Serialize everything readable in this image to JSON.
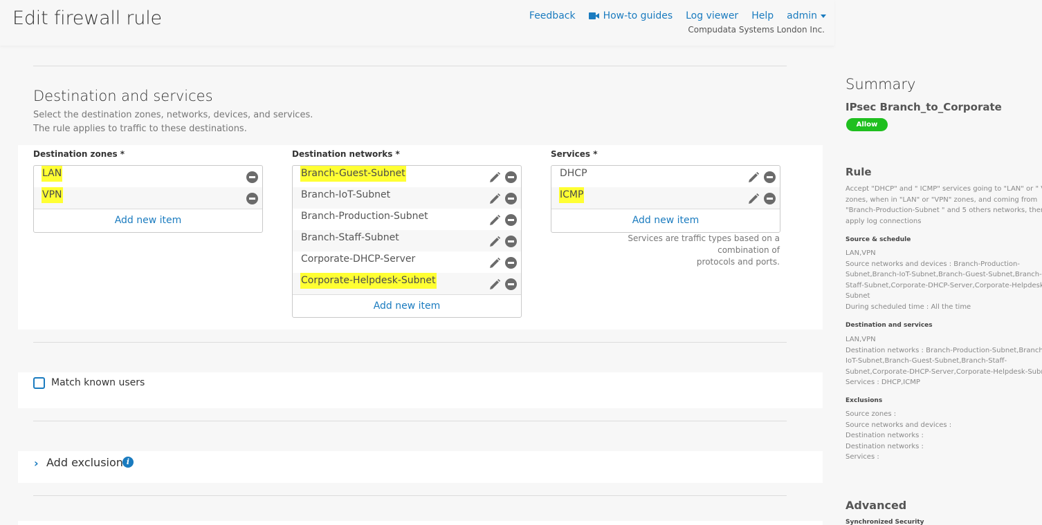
{
  "header": {
    "title": "Edit firewall rule",
    "nav": {
      "feedback": "Feedback",
      "howto": "How-to guides",
      "logviewer": "Log viewer",
      "help": "Help",
      "admin": "admin"
    },
    "company": "Compudata Systems London Inc."
  },
  "destination": {
    "title": "Destination and services",
    "desc1": "Select the destination zones, networks, devices, and services.",
    "desc2": "The rule applies to traffic to these destinations.",
    "zones": {
      "label": "Destination zones *",
      "items": [
        "LAN",
        "VPN"
      ],
      "add": "Add new item"
    },
    "networks": {
      "label": "Destination networks *",
      "items": [
        "Branch-Guest-Subnet",
        "Branch-IoT-Subnet",
        "Branch-Production-Subnet",
        "Branch-Staff-Subnet",
        "Corporate-DHCP-Server",
        "Corporate-Helpdesk-Subnet"
      ],
      "add": "Add new item"
    },
    "services": {
      "label": "Services *",
      "items": [
        "DHCP",
        "ICMP"
      ],
      "add": "Add new item",
      "note1": "Services are traffic types based on a combination of",
      "note2": "protocols and ports."
    }
  },
  "users": {
    "match_label": "Match known users",
    "checked": false
  },
  "exclusion": {
    "label": "Add exclusion"
  },
  "colors": {
    "accent": "#1a7bbf",
    "highlight": "#ffff33",
    "allow": "#1fbf1f"
  },
  "summary": {
    "title": "Summary",
    "rule_name": "IPsec Branch_to_Corporate",
    "action": "Allow",
    "rule_heading": "Rule",
    "rule_text": "Accept \"DHCP\" and \" ICMP\" services going to \"LAN\" or \" VPN\"\nzones, when in \"LAN\" or \"VPN\" zones, and coming from\n\"Branch-Production-Subnet \" and 5 others networks, then\napply log connections",
    "source_heading": "Source & schedule",
    "source_text": "LAN,VPN\nSource networks and devices : Branch-Production-\nSubnet,Branch-IoT-Subnet,Branch-Guest-Subnet,Branch-\nStaff-Subnet,Corporate-DHCP-Server,Corporate-Helpdesk-\nSubnet\nDuring scheduled time : All the time",
    "dest_heading": "Destination and services",
    "dest_text": "LAN,VPN\nDestination networks : Branch-Production-Subnet,Branch-\nIoT-Subnet,Branch-Guest-Subnet,Branch-Staff-\nSubnet,Corporate-DHCP-Server,Corporate-Helpdesk-Subnet\nServices : DHCP,ICMP",
    "excl_heading": "Exclusions",
    "excl_text": "Source zones :\nSource networks and devices :\nDestination networks :\nDestination networks :\nServices :",
    "advanced": "Advanced",
    "sync": "Synchronized Security"
  }
}
